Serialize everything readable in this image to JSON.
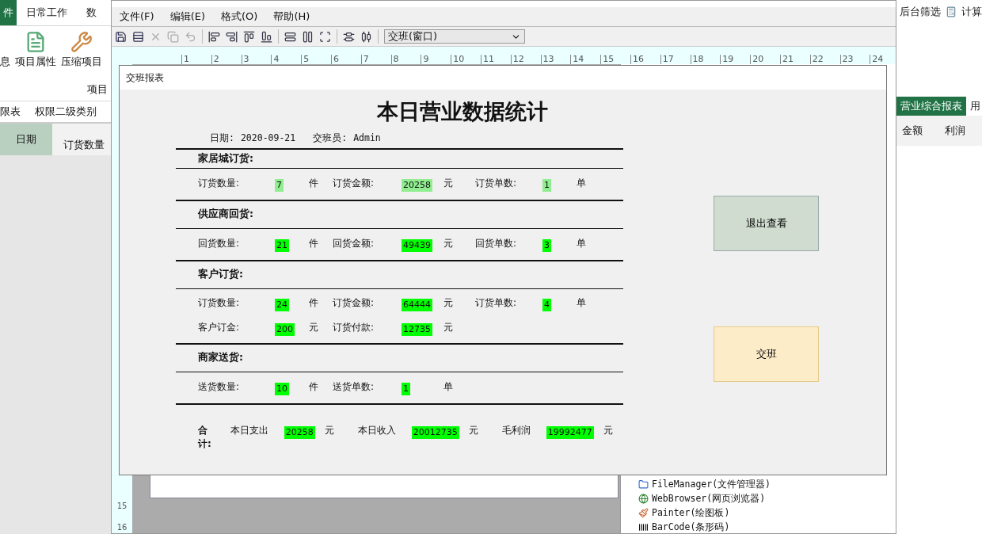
{
  "app": {
    "ribbon_tabs": [
      {
        "label": "件",
        "selected": true
      },
      {
        "label": "日常工作",
        "selected": false
      },
      {
        "label": "数",
        "selected": false
      }
    ],
    "ribbon_buttons": [
      {
        "label": "息",
        "kind": "text"
      },
      {
        "label": "项目属性",
        "kind": "properties"
      },
      {
        "label": "压缩项目",
        "kind": "compress"
      }
    ],
    "ribbon_group": "项目",
    "sheet_tabs": [
      "限表",
      "权限二级类别"
    ],
    "grid_headers": [
      "日期",
      "订货数量"
    ],
    "right_tools": [
      "后台筛选",
      "计算"
    ],
    "right_tabs": [
      {
        "label": "营业综合报表",
        "selected": true
      },
      {
        "label": "用",
        "selected": false
      }
    ],
    "right_headers": [
      "金额",
      "利润"
    ]
  },
  "designer": {
    "menu": [
      "文件(F)",
      "编辑(E)",
      "格式(O)",
      "帮助(H)"
    ],
    "object_select": "交班(窗口)",
    "ruler_marks": [
      "1",
      "2",
      "3",
      "4",
      "5",
      "6",
      "7",
      "8",
      "9",
      "10",
      "11",
      "12",
      "13",
      "14",
      "15",
      "16",
      "17",
      "18",
      "19",
      "20",
      "21",
      "22",
      "23",
      "24"
    ],
    "side_ruler_marks": [
      "15",
      "16"
    ],
    "components": [
      {
        "label": "FileManager(文件管理器)",
        "kind": "folder"
      },
      {
        "label": "WebBrowser(网页浏览器)",
        "kind": "browser"
      },
      {
        "label": "Painter(绘图板)",
        "kind": "paint"
      },
      {
        "label": "BarCode(条形码)",
        "kind": "barcode"
      }
    ]
  },
  "report": {
    "window_title": "交班报表",
    "heading": "本日营业数据统计",
    "date_label": "日期:",
    "date": "2020-09-21",
    "operator_label": "交班员:",
    "operator": "Admin",
    "sections": [
      {
        "title": "家居城订货:",
        "rows": [
          [
            {
              "label": "订货数量:",
              "value": "7",
              "unit": "件",
              "color": "#90ee90"
            },
            {
              "label": "订货金额:",
              "value": "20258",
              "unit": "元",
              "color": "#90ee90"
            },
            {
              "label": "订货单数:",
              "value": "1",
              "unit": "单",
              "color": "#90ee90"
            }
          ]
        ]
      },
      {
        "title": "供应商回货:",
        "rows": [
          [
            {
              "label": "回货数量:",
              "value": "21",
              "unit": "件",
              "color": "#00ff00"
            },
            {
              "label": "回货金额:",
              "value": "49439",
              "unit": "元",
              "color": "#00ff00"
            },
            {
              "label": "回货单数:",
              "value": "3",
              "unit": "单",
              "color": "#00ff00"
            }
          ]
        ]
      },
      {
        "title": "客户订货:",
        "rows": [
          [
            {
              "label": "订货数量:",
              "value": "24",
              "unit": "件",
              "color": "#00ff00"
            },
            {
              "label": "订货金额:",
              "value": "64444",
              "unit": "元",
              "color": "#00ff00"
            },
            {
              "label": "订货单数:",
              "value": "4",
              "unit": "单",
              "color": "#00ff00"
            }
          ],
          [
            {
              "label": "客户订金:",
              "value": "200",
              "unit": "元",
              "color": "#00ff00"
            },
            {
              "label": "订货付款:",
              "value": "12735",
              "unit": "元",
              "color": "#00ff00"
            }
          ]
        ]
      },
      {
        "title": "商家送货:",
        "rows": [
          [
            {
              "label": "送货数量:",
              "value": "10",
              "unit": "件",
              "color": "#00ff00"
            },
            {
              "label": "送货单数:",
              "value": "1",
              "unit": "单",
              "color": "#00ff00"
            }
          ]
        ]
      }
    ],
    "total_label": "合计:",
    "totals": [
      {
        "label": "本日支出",
        "value": "20258",
        "unit": "元",
        "color": "#00ff00"
      },
      {
        "label": "本日收入",
        "value": "20012735",
        "unit": "元",
        "color": "#00ff00"
      },
      {
        "label": "毛利润",
        "value": "19992477",
        "unit": "元",
        "color": "#00ff00"
      }
    ],
    "buttons": [
      {
        "label": "退出查看",
        "kind": "exit"
      },
      {
        "label": "交班",
        "kind": "handover"
      }
    ]
  }
}
